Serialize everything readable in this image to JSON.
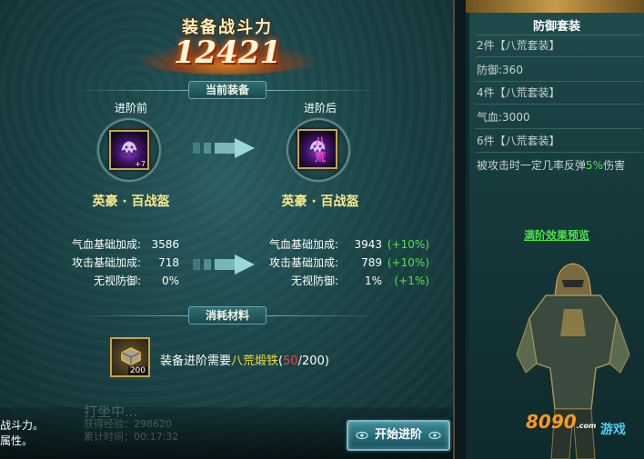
{
  "power": {
    "title": "装备战斗力",
    "value": "12421"
  },
  "sections": {
    "current_equipment": "当前装备",
    "materials": "消耗材料"
  },
  "before": {
    "label": "进阶前",
    "item_name": "英豪 · 百战盔",
    "item_level": "+7",
    "stats": [
      {
        "label": "气血基础加成:",
        "value": "3586"
      },
      {
        "label": "攻击基础加成:",
        "value": "718"
      },
      {
        "label": "无视防御:",
        "value": "0%"
      }
    ]
  },
  "after": {
    "label": "进阶后",
    "item_name": "英豪 · 百战盔",
    "badge": "八荒",
    "stats": [
      {
        "label": "气血基础加成:",
        "value": "3943",
        "inc": "(+10%)"
      },
      {
        "label": "攻击基础加成:",
        "value": "789",
        "inc": "(+10%)"
      },
      {
        "label": "无视防御:",
        "value": "1%",
        "inc": "(+1%)"
      }
    ]
  },
  "material": {
    "count": "200",
    "text_prefix": "装备进阶需要",
    "name": "八荒煅铁",
    "open": "(",
    "have": "50",
    "need": "/200)"
  },
  "background_chat": {
    "line1": "战斗力。",
    "line2": "属性。"
  },
  "ghost_text": {
    "line1": "打坐中...",
    "line2": "获得经验：298620",
    "line3": "累计时间：00:17:32"
  },
  "start_button": {
    "label": "开始进阶"
  },
  "set_panel": {
    "title": "防御套装",
    "rows": [
      "2件【八荒套装】",
      "防御:360",
      "4件【八荒套装】",
      "气血:3000",
      "6件【八荒套装】"
    ],
    "effect_prefix": "被攻击时一定几率反弹",
    "effect_value": "5%",
    "effect_suffix": "伤害",
    "full_link": "满阶效果预览"
  },
  "logo": {
    "brand": "8090",
    "dotcom": ".com",
    "cn": "游戏"
  },
  "colors": {
    "increase": "#59e04a",
    "material_name": "#f0d93a",
    "material_have": "#ff3a3a",
    "link": "#4de04a"
  }
}
